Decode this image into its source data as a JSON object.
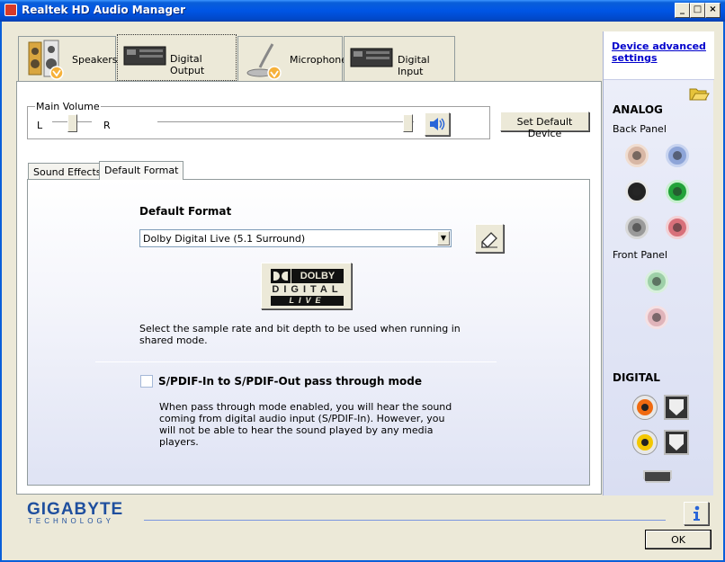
{
  "window": {
    "title": "Realtek HD Audio Manager",
    "minimize": "_",
    "maximize": "□",
    "close": "×"
  },
  "device_tabs": [
    {
      "label": "Speakers"
    },
    {
      "label": "Digital Output"
    },
    {
      "label": "Microphone"
    },
    {
      "label": "Digital Input"
    }
  ],
  "volume": {
    "title": "Main Volume",
    "left": "L",
    "right": "R",
    "balance": 0.5,
    "level": 1.0
  },
  "set_default_label": "Set Default Device",
  "inner_tabs": [
    {
      "label": "Sound Effects"
    },
    {
      "label": "Default Format"
    }
  ],
  "format": {
    "heading": "Default Format",
    "selected": "Dolby Digital Live (5.1 Surround)",
    "logo_top": "DOLBY",
    "logo_mid": "DIGITAL",
    "logo_bot": "LIVE",
    "description": "Select the sample rate and bit depth to be used when running in shared mode."
  },
  "passthrough": {
    "label": "S/PDIF-In to S/PDIF-Out pass through mode",
    "checked": false,
    "description": "When pass through mode enabled, you will hear the sound coming from digital audio input (S/PDIF-In). However, you will not be able to hear the sound played by any media players."
  },
  "sidebar": {
    "advanced_link": "Device advanced settings",
    "analog": "ANALOG",
    "back_panel": "Back Panel",
    "front_panel": "Front Panel",
    "digital": "DIGITAL"
  },
  "brand": {
    "name": "GIGABYTE",
    "sub": "TECHNOLOGY"
  },
  "ok_label": "OK",
  "colors": {
    "titlebar": "#0055e5",
    "link": "#0000cc",
    "panel_gradient_end": "#dfe3f4"
  }
}
